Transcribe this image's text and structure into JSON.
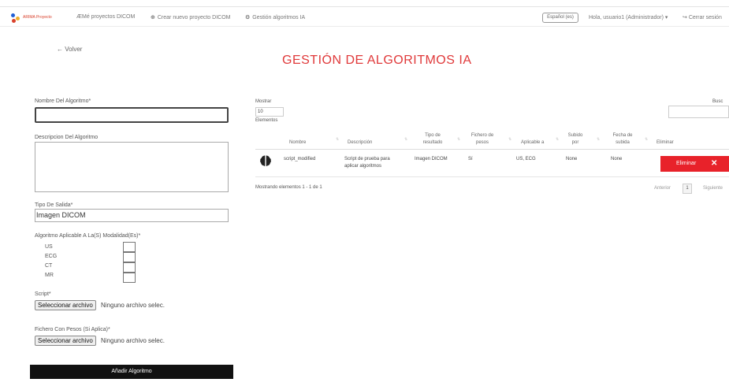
{
  "nav": {
    "logo_text": "ARIMA Proyecto",
    "link_projects": "ÆMé proyectos DICOM",
    "link_new_project": "Crear nuevo proyecto DICOM",
    "link_algorithms": "Gestión algoritmos IA",
    "language_button": "Español (es)",
    "user_menu": "Hola, usuario1 (Administrador) ▾",
    "logout": "Cerrar sesión"
  },
  "back_link": "← Volver",
  "page_title": "GESTIÓN DE ALGORITMOS IA",
  "form": {
    "name_label": "Nombre Del Algoritmo*",
    "name_value": "",
    "description_label": "Descripcion Del Algoritmo",
    "description_value": "",
    "output_label": "Tipo De Salida*",
    "output_value": "Imagen DICOM",
    "modalities_label": "Algoritmo Aplicable A La(S) Modalidad(Es)*",
    "modalities": [
      "US",
      "ECG",
      "CT",
      "MR"
    ],
    "script_label": "Script*",
    "weights_label": "Fichero Con Pesos (Si Aplica)*",
    "file_button": "Seleccionar archivo",
    "file_none": "Ninguno archivo selec.",
    "submit": "Añadir Algoritmo"
  },
  "table": {
    "show_label": "Mostrar",
    "page_size": "10",
    "elements_label": "Elementos",
    "search_label": "Busc",
    "columns": [
      "Nombre",
      "Descripción",
      "Tipo de resultado",
      "Fichero de pesos",
      "Aplicable a",
      "Subido por",
      "Fecha de subida",
      "Eliminar"
    ],
    "rows": [
      {
        "icon": "brain-icon",
        "name": "script_modified",
        "description": "Script de prueba para aplicar algoritmos",
        "result_type": "Imagen DICOM",
        "weights": "Sí",
        "applicable": "US, ECG",
        "uploaded_by": "None",
        "upload_date": "None",
        "delete_label": "Eliminar"
      }
    ],
    "footer_info": "Mostrando elementos 1 - 1 de 1",
    "prev": "Anterior",
    "page": "1",
    "next": "Siguiente"
  },
  "colors": {
    "accent": "#e0393a",
    "delete": "#e8222a",
    "submit_bg": "#111111"
  }
}
